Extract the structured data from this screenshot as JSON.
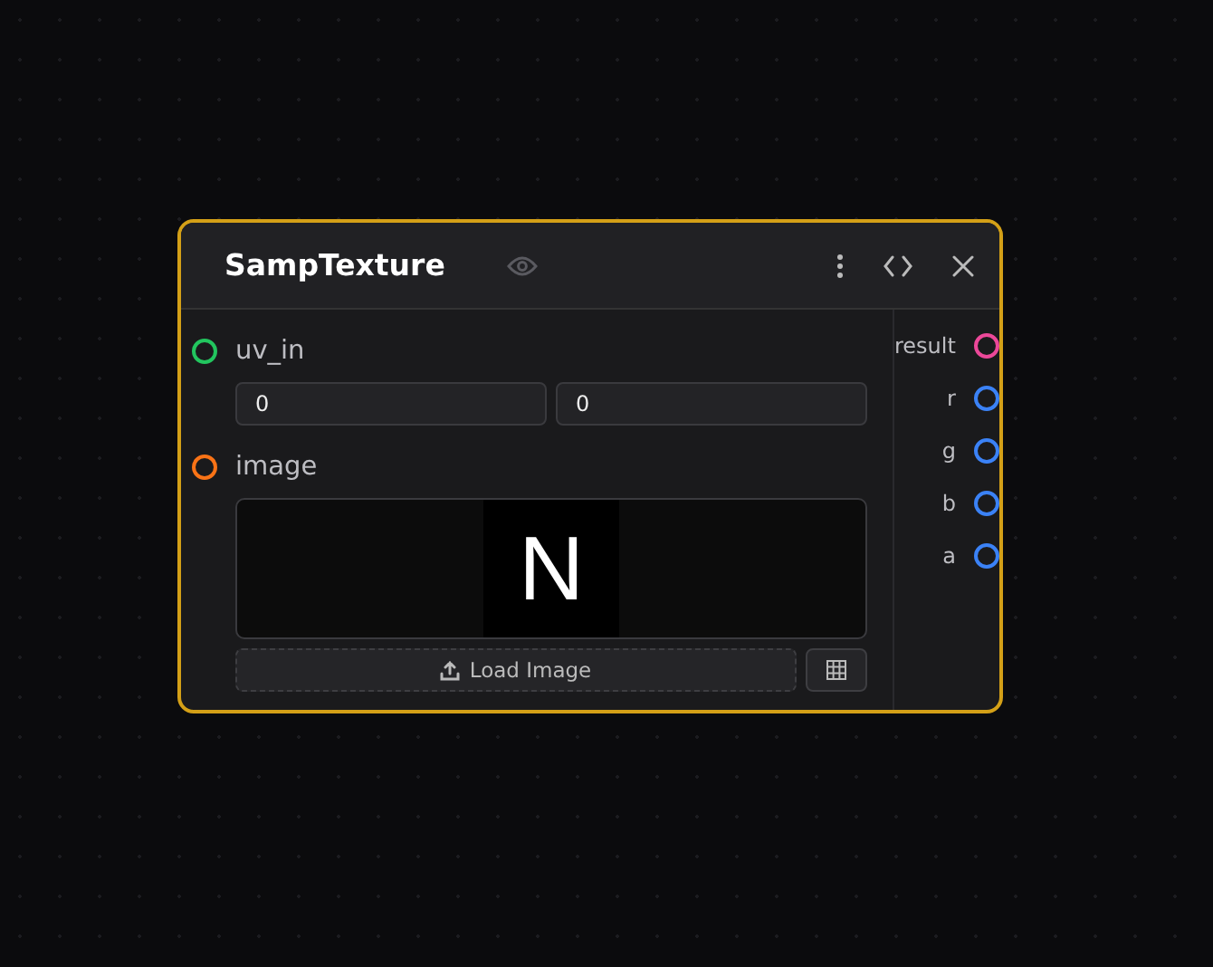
{
  "node": {
    "title": "SampTexture",
    "selected": true,
    "inputs": [
      {
        "label": "uv_in",
        "color": "#22c55e",
        "kind": "vector",
        "values": [
          "0",
          "0"
        ]
      },
      {
        "label": "image",
        "color": "#f97316",
        "kind": "image",
        "preview_text": "N",
        "button": "Load Image"
      }
    ],
    "outputs": [
      {
        "label": "result",
        "color": "#ec4899"
      },
      {
        "label": "r",
        "color": "#3b82f6"
      },
      {
        "label": "g",
        "color": "#3b82f6"
      },
      {
        "label": "b",
        "color": "#3b82f6"
      },
      {
        "label": "a",
        "color": "#3b82f6"
      }
    ]
  }
}
